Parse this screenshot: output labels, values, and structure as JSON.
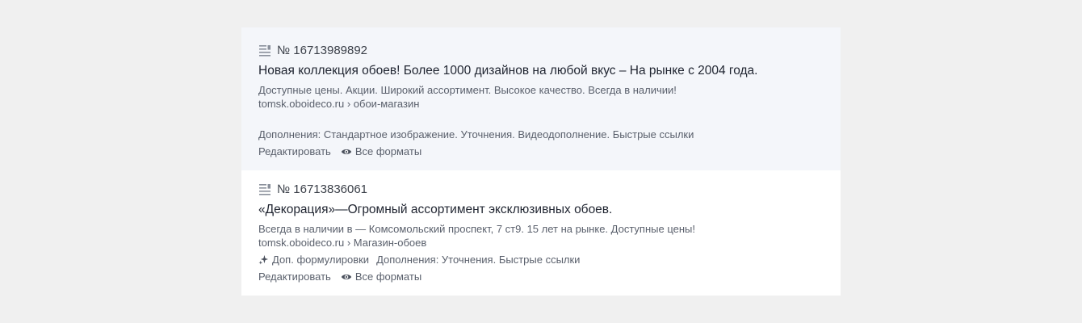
{
  "ads": [
    {
      "number": "№ 16713989892",
      "headline": "Новая коллекция обоев! Более 1000 дизайнов на любой вкус – На рынке с 2004 года.",
      "text": "Доступные цены. Акции. Широкий ассортимент. Высокое качество. Всегда в наличии!",
      "url": "tomsk.oboideco.ru › обои-магазин",
      "extensions": "Дополнения: Стандартное изображение. Уточнения. Видеодополнение. Быстрые ссылки",
      "edit_label": "Редактировать",
      "formats_label": "Все форматы"
    },
    {
      "number": "№ 16713836061",
      "headline": "«Декорация»—Огромный ассортимент эксклюзивных обоев.",
      "text": "Всегда в наличии в — Комсомольский проспект, 7 ст9. 15 лет на рынке. Доступные цены!",
      "url": "tomsk.oboideco.ru › Магазин-обоев",
      "alt_wording_label": "Доп. формулировки",
      "extensions": "Дополнения: Уточнения. Быстрые ссылки",
      "edit_label": "Редактировать",
      "formats_label": "Все форматы"
    }
  ],
  "icons": {
    "ad_number": "document-lines-icon",
    "alt_wording": "sparkle-icon",
    "formats": "eye-icon"
  }
}
